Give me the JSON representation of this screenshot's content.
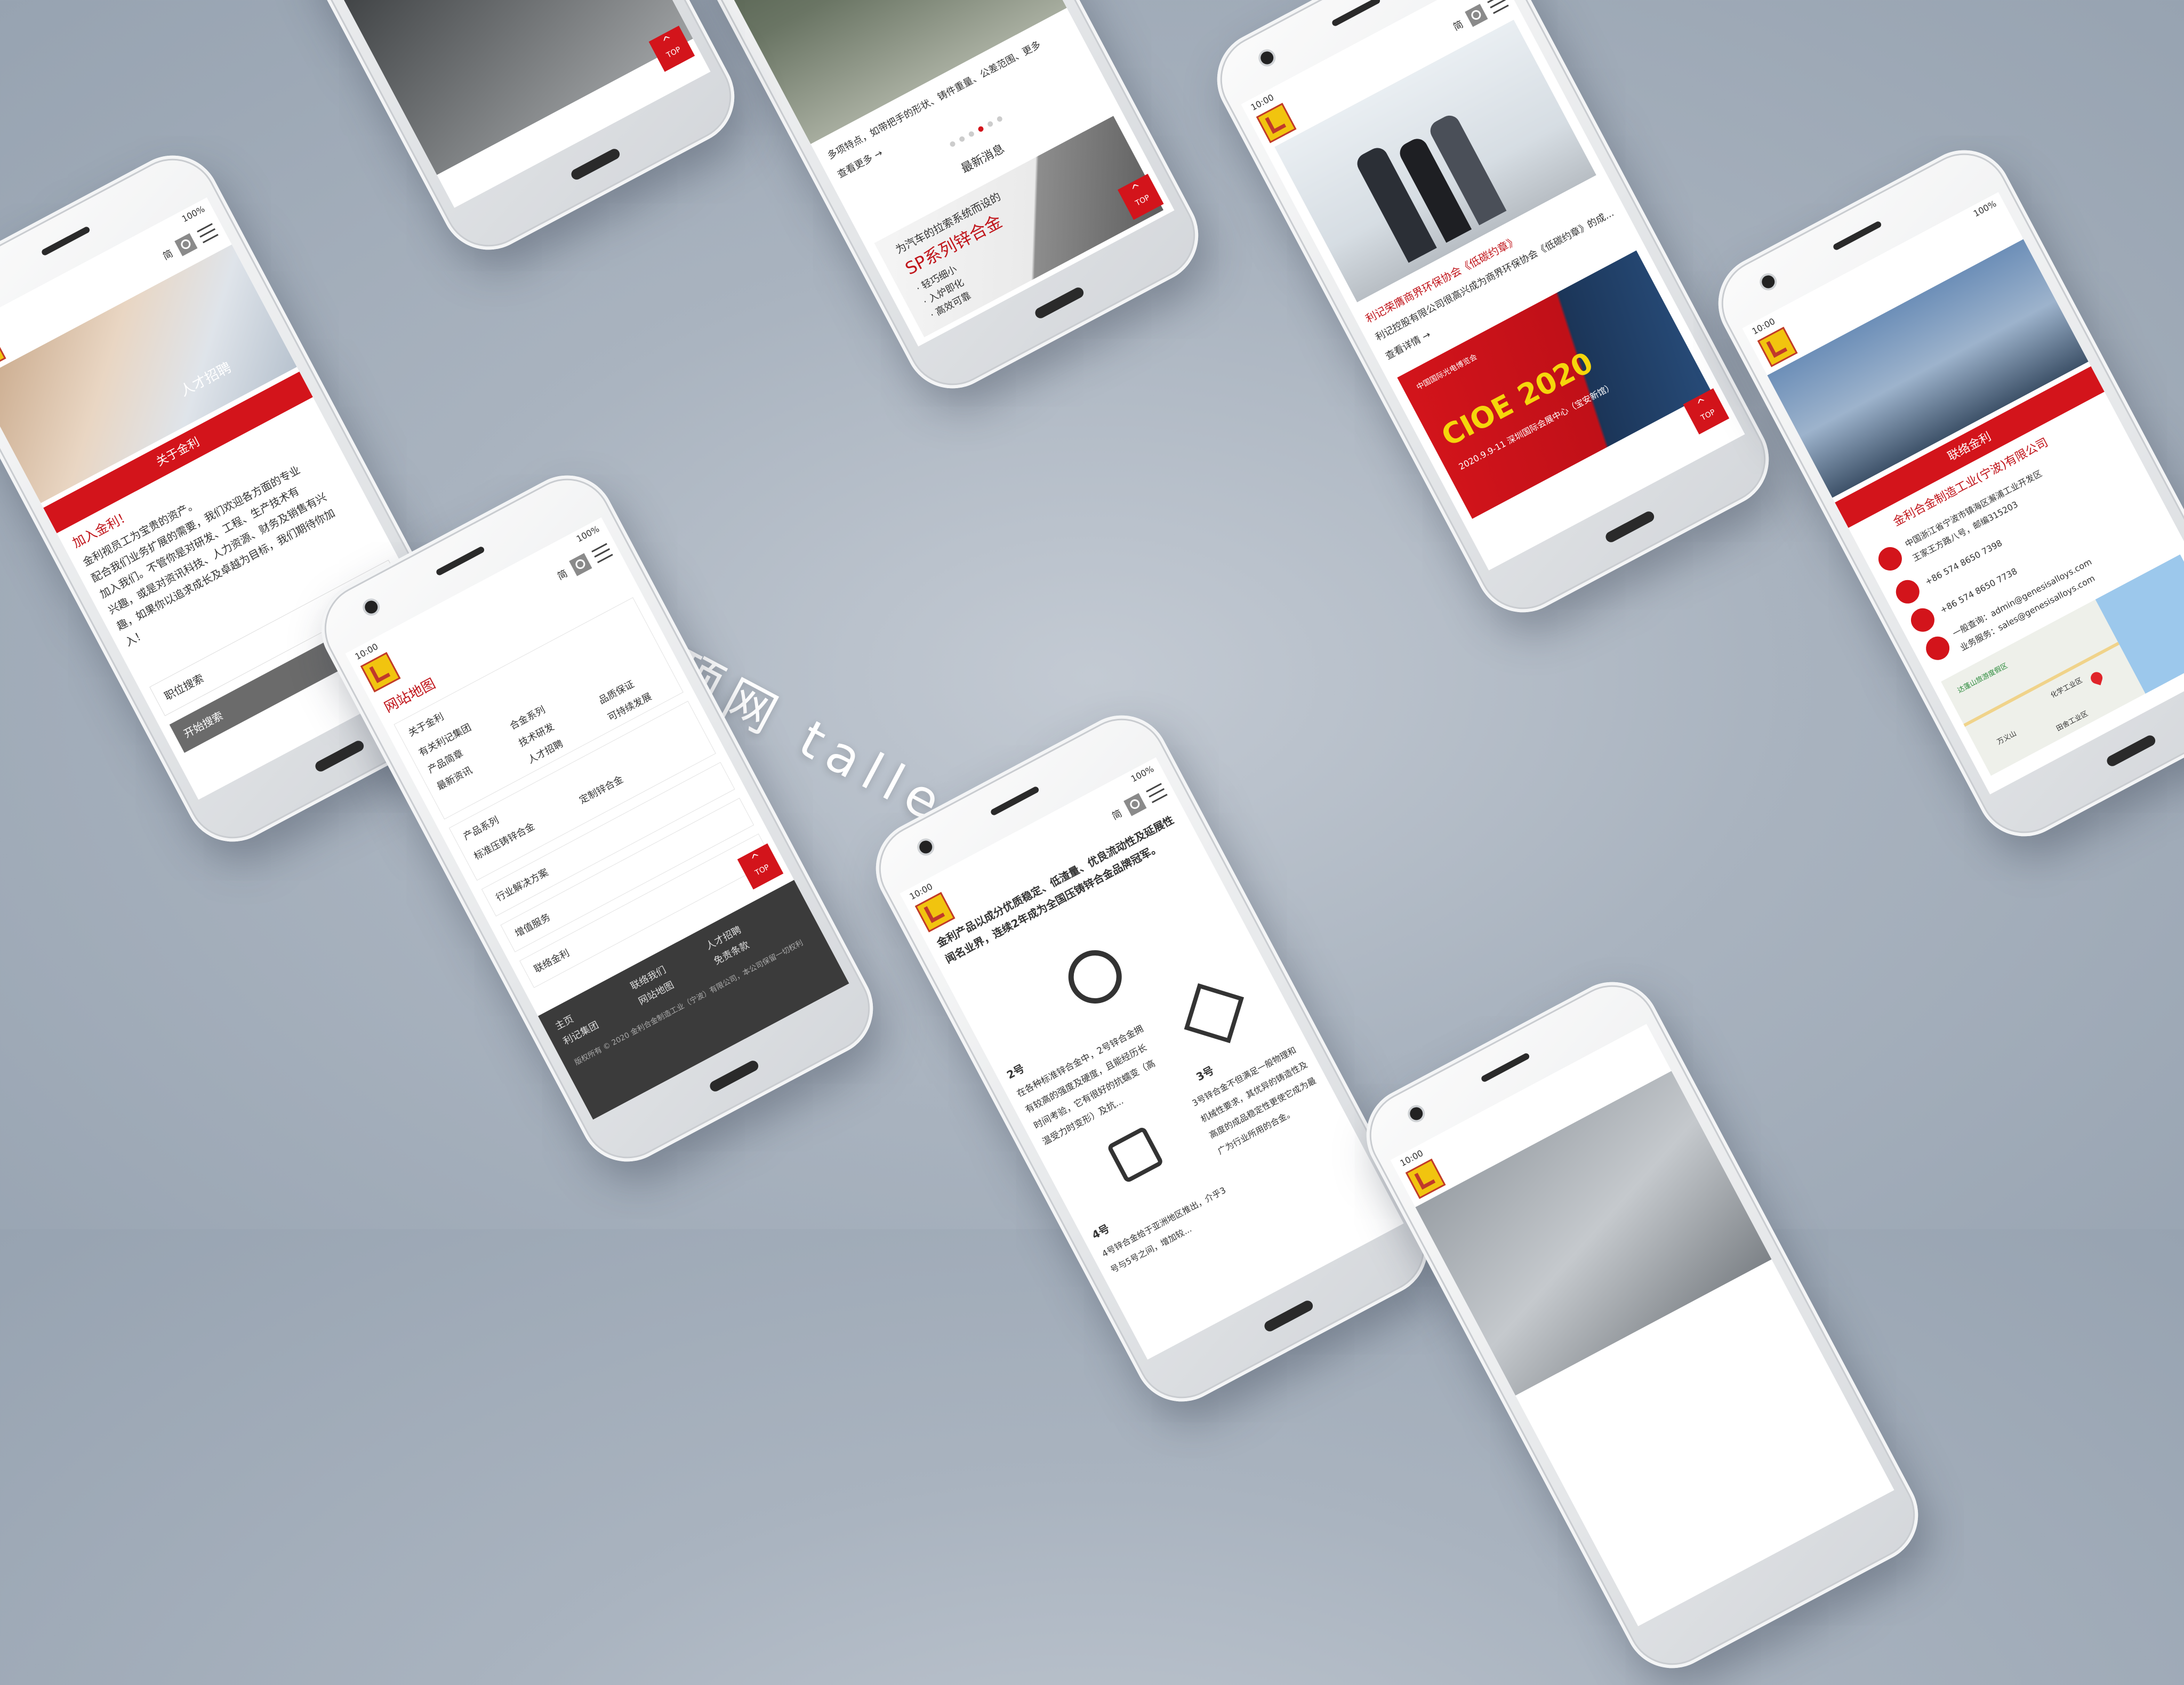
{
  "headline": "顶网 tallestweb 建站",
  "common": {
    "time": "10:00",
    "battery": "100%",
    "lang": "简",
    "top_label": "TOP"
  },
  "phone_join": {
    "tag": "人才招聘",
    "nav_label": "关于金利",
    "heading": "加入金利！",
    "lines": [
      "金利视员工为宝贵的资产。",
      "配合我们业务扩展的需要，我们欢迎各方面的专业",
      "加入我们。不管你是对研发、工程、生产技术有",
      "兴趣，或是对资讯科技、人力资源、财务及销售有兴",
      "趣，如果你以追求成长及卓越为目标，我们期待你加",
      "入！"
    ],
    "search_label": "职位搜索",
    "start_search": "开始搜索"
  },
  "phone_sitemap": {
    "title": "网站地图",
    "about": "关于金利",
    "about_items": [
      "有关利记集团",
      "产品简章",
      "合金系列",
      "最新资讯",
      "技术研发",
      "品质保证",
      "人才招聘",
      "可持续发展"
    ],
    "products": "产品系列",
    "product_items": [
      "标准压铸锌合金",
      "定制锌合金"
    ],
    "solutions": "行业解决方案",
    "value_added": "增值服务",
    "contact": "联络金利",
    "footer": [
      "主页",
      "利记集团",
      "联络我们",
      "网站地图",
      "人才招聘",
      "免责条款"
    ],
    "copyright": "版权所有 © 2020 金利合金制造工业（宁波）有限公司，本公司保留一切权利"
  },
  "phone_news_top": {
    "more": "查看更多 →",
    "snippet": "多项特点，如带把手的形状、铸件重量、公差范围、更多",
    "section": "最新消息",
    "banner_line1": "为汽车的拉索系统而设的",
    "banner_line2": "SP系列锌合金",
    "bullets": [
      "· 轻巧细小",
      "· 入炉即化",
      "· 高效可靠"
    ]
  },
  "phone_news": {
    "headline": "利记荣膺商界环保协会《低碳约章》",
    "desc": "利记控股有限公司很高兴成为商界环保协会《低碳约章》的成...",
    "more": "查看详情 →",
    "cioe_big": "CIOE 2020",
    "cioe_date": "2020.9.9-11 深圳国际会展中心（宝安新馆）",
    "cioe_small": "中国国际光电博览会"
  },
  "phone_contact": {
    "nav": "联络金利",
    "company": "金利合金制造工业(宁波)有限公司",
    "address": "中国浙江省宁波市镇海区澥浦工业开发区",
    "address2": "王家王方路八号，邮编315203",
    "phone": "+86 574 8650 7398",
    "fax": "+86 574 8650 7738",
    "email1": "一般查询：admin@genesisalloys.com",
    "email2": "业务服务：sales@genesisalloys.com",
    "map_labels": [
      "达蓬山旅游度假区",
      "万义山",
      "田舍工业区",
      "化学工业区"
    ]
  },
  "phone_alloys": {
    "intro": "金利产品以成分优质稳定、低渣量、优良流动性及延展性闻名业界，连续2年成为全国压铸锌合金品牌冠军。",
    "no2": "2号",
    "no2_desc": "在各种标准锌合金中，2号锌合金拥有较高的强度及硬度，且能经历长时间考验，它有很好的抗蠕变（高温受力时变形）及抗...",
    "no3": "3号",
    "no3_desc": "3号锌合金不但满足一般物理和机械性要求，其优异的铸造性及高度的成品稳定性更使它成为最广为行业所用的合金。",
    "no4": "4号",
    "no4_desc": "4号锌合金给于亚洲地区推出，介乎3号与5号之间，增加较..."
  }
}
